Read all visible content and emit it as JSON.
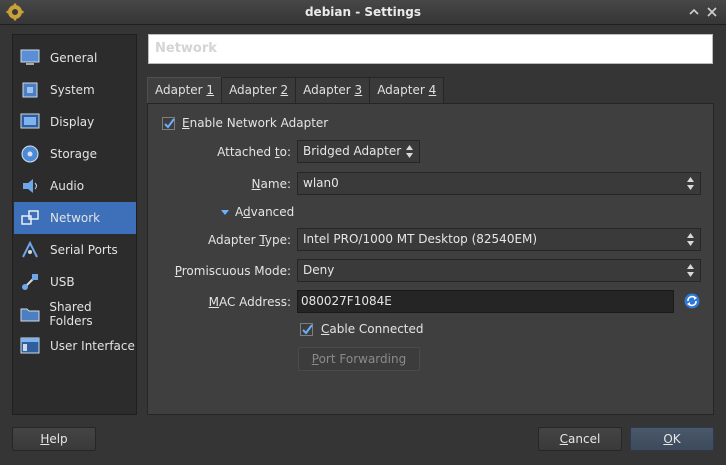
{
  "window": {
    "title": "debian - Settings"
  },
  "sidebar": {
    "items": [
      {
        "label": "General",
        "icon": "monitor-icon"
      },
      {
        "label": "System",
        "icon": "chip-icon"
      },
      {
        "label": "Display",
        "icon": "display-icon"
      },
      {
        "label": "Storage",
        "icon": "disk-icon"
      },
      {
        "label": "Audio",
        "icon": "speaker-icon"
      },
      {
        "label": "Network",
        "icon": "network-icon",
        "active": true
      },
      {
        "label": "Serial Ports",
        "icon": "serial-icon"
      },
      {
        "label": "USB",
        "icon": "usb-icon"
      },
      {
        "label": "Shared Folders",
        "icon": "folder-icon"
      },
      {
        "label": "User Interface",
        "icon": "window-icon"
      }
    ]
  },
  "page": {
    "title": "Network"
  },
  "tabs": [
    {
      "pre": "Adapter ",
      "key": "1",
      "active": true
    },
    {
      "pre": "Adapter ",
      "key": "2"
    },
    {
      "pre": "Adapter ",
      "key": "3"
    },
    {
      "pre": "Adapter ",
      "key": "4"
    }
  ],
  "adapter": {
    "enable": {
      "pre": "",
      "key": "E",
      "post": "nable Network Adapter",
      "checked": true
    },
    "attached_to": {
      "pre": "Attached ",
      "key": "t",
      "post": "o:",
      "value": "Bridged Adapter"
    },
    "name": {
      "pre": "",
      "key": "N",
      "post": "ame:",
      "value": "wlan0"
    },
    "advanced": {
      "pre": "A",
      "key": "d",
      "post": "vanced"
    },
    "adapter_type": {
      "pre": "Adapter ",
      "key": "T",
      "post": "ype:",
      "value": "Intel PRO/1000 MT Desktop (82540EM)"
    },
    "promiscuous": {
      "pre": "",
      "key": "P",
      "post": "romiscuous Mode:",
      "value": "Deny"
    },
    "mac": {
      "pre": "",
      "key": "M",
      "post": "AC Address:",
      "value": "080027F1084E"
    },
    "cable": {
      "pre": "",
      "key": "C",
      "post": "able Connected",
      "checked": true
    },
    "port_forwarding": {
      "pre": "",
      "key": "P",
      "post": "ort Forwarding"
    }
  },
  "buttons": {
    "help": {
      "pre": "",
      "key": "H",
      "post": "elp"
    },
    "cancel": {
      "pre": "",
      "key": "C",
      "post": "ancel"
    },
    "ok": {
      "pre": "",
      "key": "O",
      "post": "K"
    }
  },
  "colors": {
    "accent": "#3d70b8",
    "check": "#6ab0ff"
  }
}
